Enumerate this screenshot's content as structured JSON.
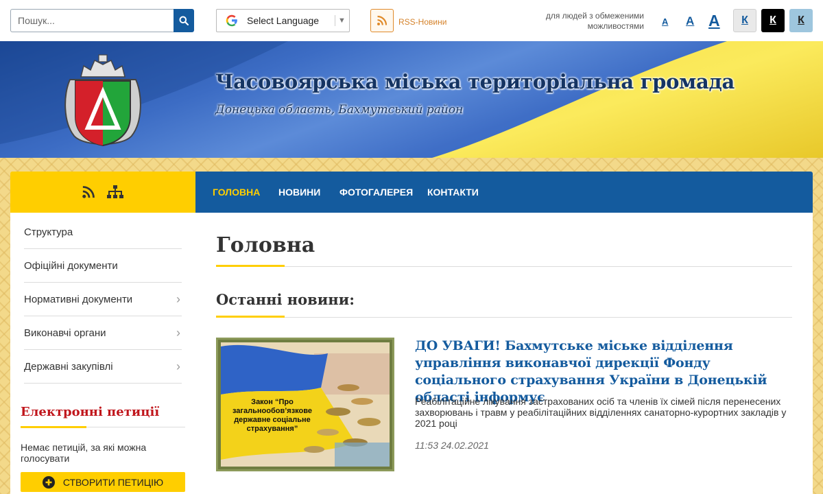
{
  "topbar": {
    "search_placeholder": "Пошук...",
    "language_label": "Select Language",
    "rss_label": "RSS-Новини",
    "accessibility_label": "для людей з обмеженими можливостями",
    "font_sizes": [
      "A",
      "A",
      "A"
    ],
    "contrast_buttons": [
      "К",
      "К",
      "К"
    ]
  },
  "header": {
    "title": "Часовоярська міська територіальна громада",
    "subtitle": "Донецька область, Бахмутський район"
  },
  "nav": {
    "items": [
      {
        "label": "ГОЛОВНА",
        "active": true
      },
      {
        "label": "НОВИНИ",
        "active": false
      },
      {
        "label": "ФОТОГАЛЕРЕЯ",
        "active": false
      },
      {
        "label": "КОНТАКТИ",
        "active": false
      }
    ]
  },
  "sidebar": {
    "items": [
      {
        "label": "Структура",
        "has_submenu": false
      },
      {
        "label": "Офіційні документи",
        "has_submenu": false
      },
      {
        "label": "Нормативні документи",
        "has_submenu": true
      },
      {
        "label": "Виконавчі органи",
        "has_submenu": true
      },
      {
        "label": "Державні закупівлі",
        "has_submenu": true
      }
    ],
    "petitions": {
      "title": "Електронні петиції",
      "empty_text": "Немає петицій, за які можна голосувати",
      "create_button": "СТВОРИТИ ПЕТИЦІЮ"
    }
  },
  "main": {
    "page_title": "Головна",
    "section_title": "Останні новини:",
    "news": [
      {
        "title": "ДО УВАГИ! Бахмутське міське відділення управління виконавчої дирекції Фонду соціального страхування України в Донецькій області інформує",
        "lead": "Реабілітаційне лікування застрахованих осіб та членів їх сімей після перенесених захворювань і травм у реабілітаційних відділеннях санаторно-курортних закладів у 2021 році",
        "date": "11:53 24.02.2021",
        "image_caption": "Закон “Про загальнообов’язкове державне соціальне страхування”"
      }
    ]
  },
  "colors": {
    "primary_blue": "#145b9e",
    "accent_yellow": "#ffce00",
    "petition_red": "#c0151b",
    "rss_orange": "#e08a2a"
  }
}
